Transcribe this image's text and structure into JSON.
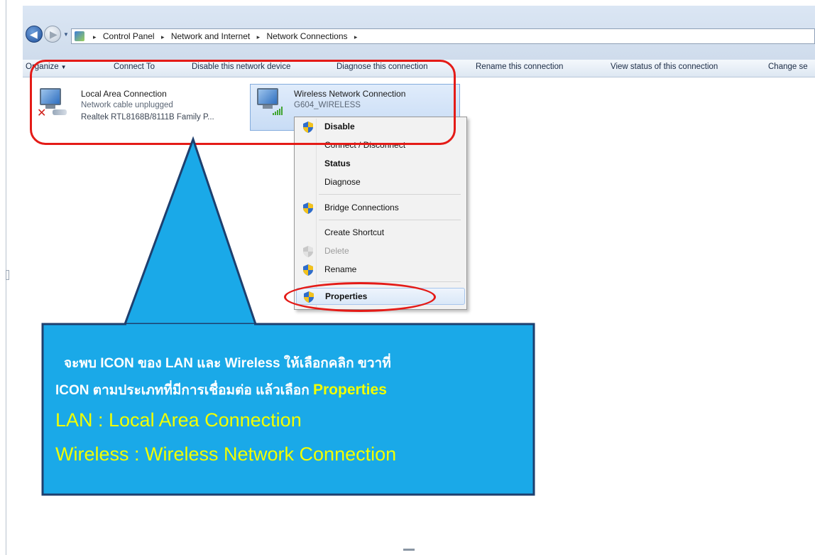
{
  "address_bar": {
    "crumbs": [
      "Control Panel",
      "Network and Internet",
      "Network Connections"
    ],
    "separator": "▸"
  },
  "toolbar": {
    "items": [
      "Organize",
      "Connect To",
      "Disable this network device",
      "Diagnose this connection",
      "Rename this connection",
      "View status of this connection",
      "Change se"
    ]
  },
  "connections": [
    {
      "name": "Local Area Connection",
      "status": "Network cable unplugged",
      "device": "Realtek RTL8168B/8111B Family P...",
      "icon": "wired-network-icon",
      "error": true
    },
    {
      "name": "Wireless Network Connection",
      "status": "G604_WIRELESS",
      "icon": "wireless-network-icon",
      "selected": true
    }
  ],
  "context_menu": {
    "items": [
      {
        "label": "Disable",
        "bold": true,
        "icon": "shield-icon"
      },
      {
        "label": "Connect / Disconnect"
      },
      {
        "label": "Status",
        "bold": true
      },
      {
        "label": "Diagnose"
      },
      {
        "label": "Bridge Connections",
        "icon": "shield-icon"
      },
      {
        "label": "Create Shortcut"
      },
      {
        "label": "Delete",
        "disabled": true,
        "icon": "shield-icon"
      },
      {
        "label": "Rename",
        "icon": "shield-icon"
      },
      {
        "label": "Properties",
        "bold": true,
        "icon": "shield-icon",
        "highlighted": true
      }
    ]
  },
  "callout": {
    "line1": "จะพบ ICON  ของ LAN และ Wireless  ให้เลือกคลิก  ขวาที่",
    "line2": "ICON ตามประเภทที่มีการเชื่อมต่อ  แล้วเลือก",
    "line2_highlight": "Properties",
    "line3": "LAN : Local Area Connection",
    "line4": "Wireless : Wireless  Network  Connection"
  },
  "colors": {
    "callout_fill": "#1aa9e8",
    "callout_border": "#1e3f6e",
    "callout_text": "#ffffff",
    "callout_highlight": "#f2ff00",
    "highlight_outline": "#e41b17"
  }
}
